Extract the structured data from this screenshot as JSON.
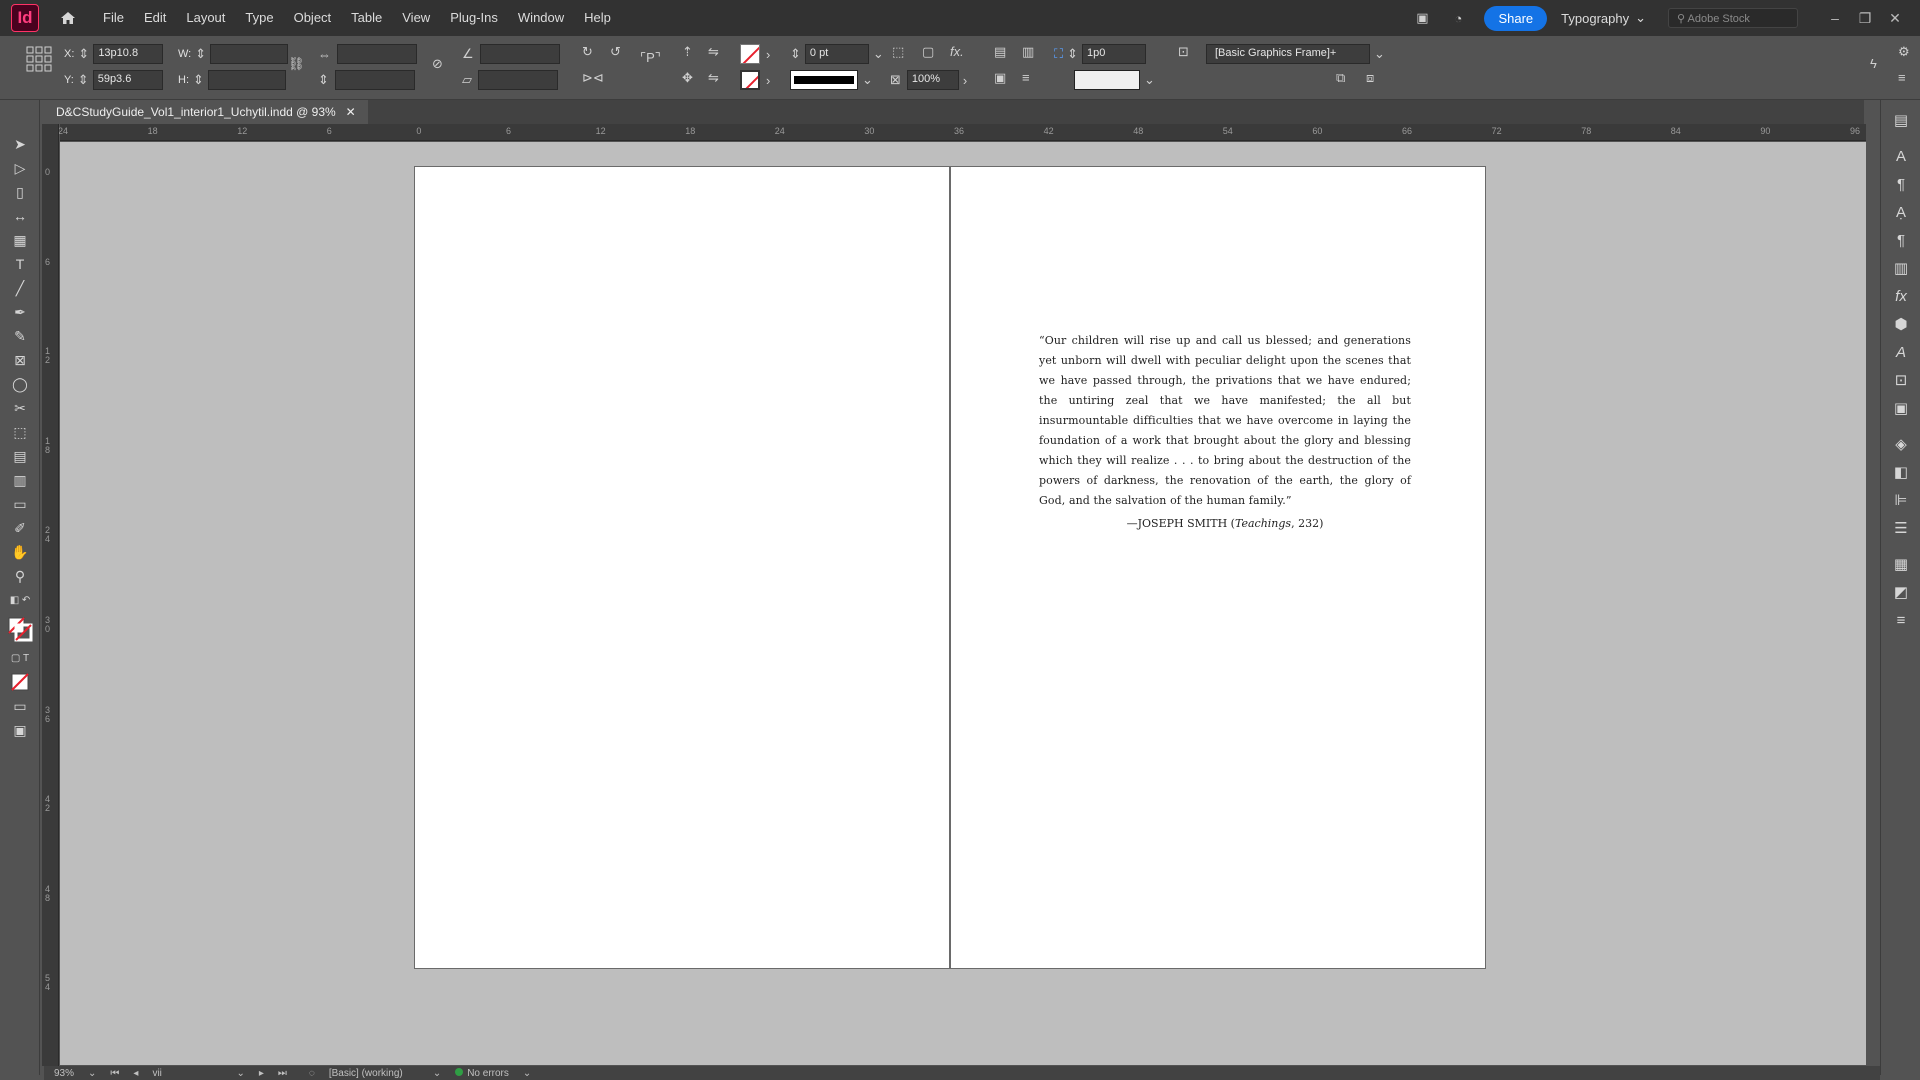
{
  "app": {
    "logo": "Id",
    "menu": [
      "File",
      "Edit",
      "Layout",
      "Type",
      "Object",
      "Table",
      "View",
      "Plug-Ins",
      "Window",
      "Help"
    ],
    "share_label": "Share",
    "workspace": "Typography",
    "stock_placeholder": "Adobe Stock"
  },
  "control_panel": {
    "x_label": "X:",
    "x_value": "13p10.8",
    "y_label": "Y:",
    "y_value": "59p3.6",
    "w_label": "W:",
    "h_label": "H:",
    "stroke_weight": "0 pt",
    "opacity": "100%",
    "frame_offset": "1p0",
    "object_style": "[Basic Graphics Frame]+"
  },
  "document": {
    "tab_title": "D&CStudyGuide_Vol1_interior1_Uchytil.indd @ 93%",
    "quote": "“Our children will rise up and call us blessed; and generations yet unborn will dwell with peculiar delight upon the scenes that we have passed through, the privations that we have endured; the untiring zeal that we have manifested; the all but insurmountable difficulties that we have overcome in laying the foundation of a work that brought about the glory and blessing which they will realize . . . to bring about the destruction of the powers of darkness, the renovation of the earth, the glory of God, and the salvation of the human family.”",
    "attribution_prefix": "—JOSEPH SMITH (",
    "attribution_work": "Teachings",
    "attribution_suffix": ", 232)"
  },
  "rulers": {
    "horizontal": [
      "24",
      "18",
      "12",
      "6",
      "0",
      "6",
      "12",
      "18",
      "24",
      "30",
      "36",
      "42",
      "48",
      "54",
      "60",
      "66",
      "72",
      "78",
      "84",
      "90",
      "96"
    ],
    "vertical": [
      "0",
      "6",
      "1 2",
      "1 8",
      "2 4",
      "3 0",
      "3 6",
      "4 2",
      "4 8",
      "5 4"
    ]
  },
  "statusbar": {
    "zoom": "93%",
    "page": "vii",
    "preflight_profile": "[Basic] (working)",
    "errors": "No errors"
  },
  "colors": {
    "accent": "#1473e6",
    "logo_bg": "#49021f",
    "logo_fg": "#ff3d7f",
    "ok": "#2f9e44"
  }
}
